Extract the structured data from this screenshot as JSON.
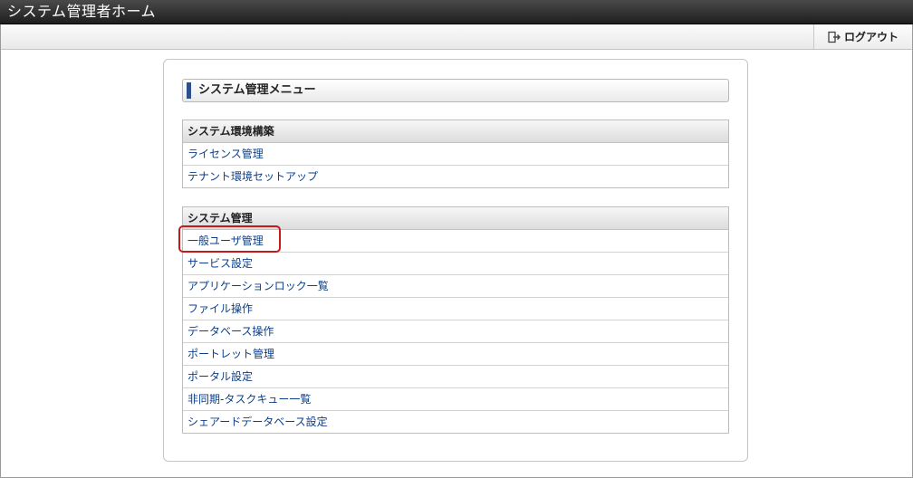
{
  "window": {
    "title": "システム管理者ホーム"
  },
  "toolbar": {
    "logout_label": "ログアウト"
  },
  "panel": {
    "title": "システム管理メニュー"
  },
  "sections": [
    {
      "heading": "システム環境構築",
      "items": [
        "ライセンス管理",
        "テナント環境セットアップ"
      ]
    },
    {
      "heading": "システム管理",
      "items": [
        "一般ユーザ管理",
        "サービス設定",
        "アプリケーションロック一覧",
        "ファイル操作",
        "データベース操作",
        "ポートレット管理",
        "ポータル設定",
        "非同期-タスクキュー一覧",
        "シェアードデータベース設定"
      ]
    }
  ],
  "colors": {
    "accent_bar": "#2d4f8e",
    "link": "#0b3f8a",
    "highlight": "#c41a1a"
  }
}
